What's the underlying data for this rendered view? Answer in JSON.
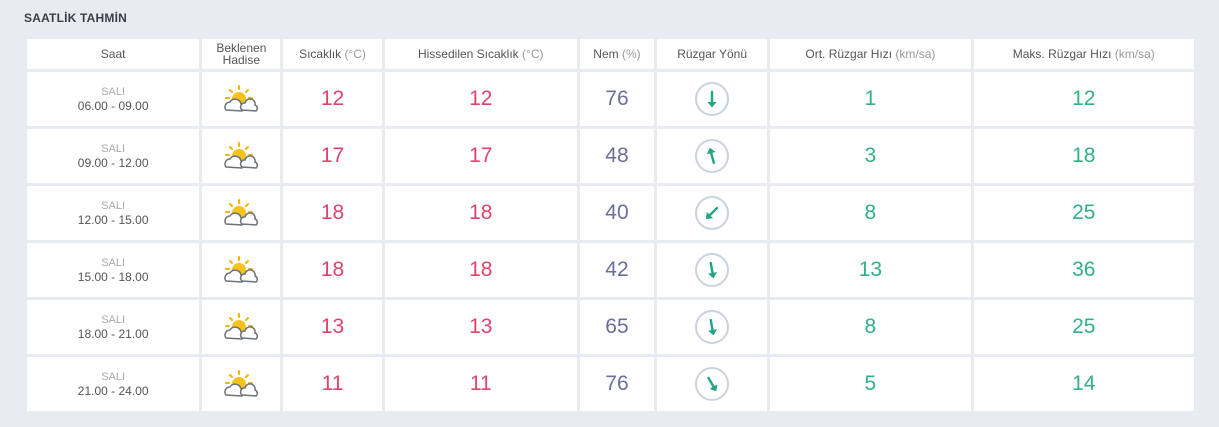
{
  "section": {
    "title": "SAATLİK TAHMİN"
  },
  "headers": {
    "time": "Saat",
    "event_line1": "Beklenen",
    "event_line2": "Hadise",
    "temp": "Sıcaklık",
    "temp_unit": "(°C)",
    "feels": "Hissedilen Sıcaklık",
    "feels_unit": "(°C)",
    "humidity": "Nem",
    "humidity_unit": "(%)",
    "wind_dir": "Rüzgar Yönü",
    "wind_avg": "Ort. Rüzgar Hızı",
    "wind_avg_unit": "(km/sa)",
    "wind_max": "Maks. Rüzgar Hızı",
    "wind_max_unit": "(km/sa)"
  },
  "colors": {
    "temp": "#e2436a",
    "humidity": "#6b6f9a",
    "wind": "#33b08a",
    "arrow": "#1fa584"
  },
  "rows": [
    {
      "day": "SALI",
      "hours": "06.00 - 09.00",
      "event_icon": "partly-cloudy-icon",
      "temp": "12",
      "feels": "12",
      "humidity": "76",
      "wind_dir_deg": 180,
      "wind_avg": "1",
      "wind_max": "12"
    },
    {
      "day": "SALI",
      "hours": "09.00 - 12.00",
      "event_icon": "partly-cloudy-icon",
      "temp": "17",
      "feels": "17",
      "humidity": "48",
      "wind_dir_deg": 345,
      "wind_avg": "3",
      "wind_max": "18"
    },
    {
      "day": "SALI",
      "hours": "12.00 - 15.00",
      "event_icon": "partly-cloudy-icon",
      "temp": "18",
      "feels": "18",
      "humidity": "40",
      "wind_dir_deg": 225,
      "wind_avg": "8",
      "wind_max": "25"
    },
    {
      "day": "SALI",
      "hours": "15.00 - 18.00",
      "event_icon": "partly-cloudy-icon",
      "temp": "18",
      "feels": "18",
      "humidity": "42",
      "wind_dir_deg": 170,
      "wind_avg": "13",
      "wind_max": "36"
    },
    {
      "day": "SALI",
      "hours": "18.00 - 21.00",
      "event_icon": "partly-cloudy-icon",
      "temp": "13",
      "feels": "13",
      "humidity": "65",
      "wind_dir_deg": 170,
      "wind_avg": "8",
      "wind_max": "25"
    },
    {
      "day": "SALI",
      "hours": "21.00 - 24.00",
      "event_icon": "partly-cloudy-icon",
      "temp": "11",
      "feels": "11",
      "humidity": "76",
      "wind_dir_deg": 150,
      "wind_avg": "5",
      "wind_max": "14"
    }
  ]
}
